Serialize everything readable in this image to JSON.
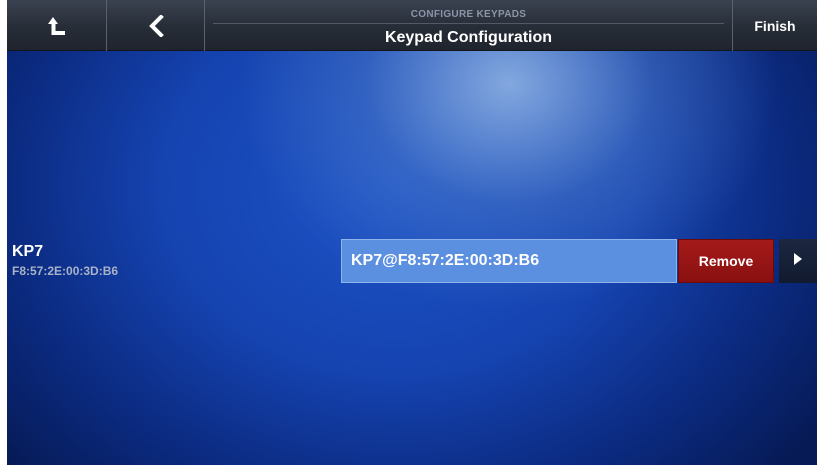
{
  "header": {
    "subtitle": "CONFIGURE KEYPADS",
    "title": "Keypad Configuration",
    "finish_label": "Finish"
  },
  "keypad": {
    "name": "KP7",
    "mac": "F8:57:2E:00:3D:B6",
    "field_value": "KP7@F8:57:2E:00:3D:B6",
    "remove_label": "Remove"
  },
  "icons": {
    "home": "up-arrow-icon",
    "back": "chevron-left-icon",
    "details": "play-arrow-icon"
  },
  "colors": {
    "remove_button": "#9b1515",
    "field_background": "#5b8fe0",
    "topbar": "#2a303a"
  }
}
